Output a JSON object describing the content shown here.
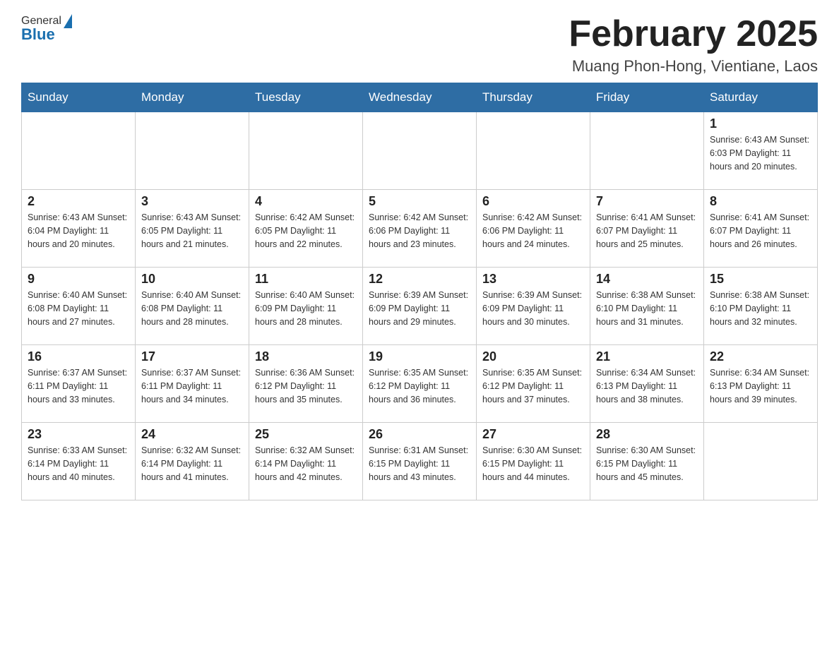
{
  "header": {
    "logo_general": "General",
    "logo_blue": "Blue",
    "month_title": "February 2025",
    "subtitle": "Muang Phon-Hong, Vientiane, Laos"
  },
  "weekdays": [
    "Sunday",
    "Monday",
    "Tuesday",
    "Wednesday",
    "Thursday",
    "Friday",
    "Saturday"
  ],
  "weeks": [
    [
      {
        "day": "",
        "info": ""
      },
      {
        "day": "",
        "info": ""
      },
      {
        "day": "",
        "info": ""
      },
      {
        "day": "",
        "info": ""
      },
      {
        "day": "",
        "info": ""
      },
      {
        "day": "",
        "info": ""
      },
      {
        "day": "1",
        "info": "Sunrise: 6:43 AM\nSunset: 6:03 PM\nDaylight: 11 hours and 20 minutes."
      }
    ],
    [
      {
        "day": "2",
        "info": "Sunrise: 6:43 AM\nSunset: 6:04 PM\nDaylight: 11 hours and 20 minutes."
      },
      {
        "day": "3",
        "info": "Sunrise: 6:43 AM\nSunset: 6:05 PM\nDaylight: 11 hours and 21 minutes."
      },
      {
        "day": "4",
        "info": "Sunrise: 6:42 AM\nSunset: 6:05 PM\nDaylight: 11 hours and 22 minutes."
      },
      {
        "day": "5",
        "info": "Sunrise: 6:42 AM\nSunset: 6:06 PM\nDaylight: 11 hours and 23 minutes."
      },
      {
        "day": "6",
        "info": "Sunrise: 6:42 AM\nSunset: 6:06 PM\nDaylight: 11 hours and 24 minutes."
      },
      {
        "day": "7",
        "info": "Sunrise: 6:41 AM\nSunset: 6:07 PM\nDaylight: 11 hours and 25 minutes."
      },
      {
        "day": "8",
        "info": "Sunrise: 6:41 AM\nSunset: 6:07 PM\nDaylight: 11 hours and 26 minutes."
      }
    ],
    [
      {
        "day": "9",
        "info": "Sunrise: 6:40 AM\nSunset: 6:08 PM\nDaylight: 11 hours and 27 minutes."
      },
      {
        "day": "10",
        "info": "Sunrise: 6:40 AM\nSunset: 6:08 PM\nDaylight: 11 hours and 28 minutes."
      },
      {
        "day": "11",
        "info": "Sunrise: 6:40 AM\nSunset: 6:09 PM\nDaylight: 11 hours and 28 minutes."
      },
      {
        "day": "12",
        "info": "Sunrise: 6:39 AM\nSunset: 6:09 PM\nDaylight: 11 hours and 29 minutes."
      },
      {
        "day": "13",
        "info": "Sunrise: 6:39 AM\nSunset: 6:09 PM\nDaylight: 11 hours and 30 minutes."
      },
      {
        "day": "14",
        "info": "Sunrise: 6:38 AM\nSunset: 6:10 PM\nDaylight: 11 hours and 31 minutes."
      },
      {
        "day": "15",
        "info": "Sunrise: 6:38 AM\nSunset: 6:10 PM\nDaylight: 11 hours and 32 minutes."
      }
    ],
    [
      {
        "day": "16",
        "info": "Sunrise: 6:37 AM\nSunset: 6:11 PM\nDaylight: 11 hours and 33 minutes."
      },
      {
        "day": "17",
        "info": "Sunrise: 6:37 AM\nSunset: 6:11 PM\nDaylight: 11 hours and 34 minutes."
      },
      {
        "day": "18",
        "info": "Sunrise: 6:36 AM\nSunset: 6:12 PM\nDaylight: 11 hours and 35 minutes."
      },
      {
        "day": "19",
        "info": "Sunrise: 6:35 AM\nSunset: 6:12 PM\nDaylight: 11 hours and 36 minutes."
      },
      {
        "day": "20",
        "info": "Sunrise: 6:35 AM\nSunset: 6:12 PM\nDaylight: 11 hours and 37 minutes."
      },
      {
        "day": "21",
        "info": "Sunrise: 6:34 AM\nSunset: 6:13 PM\nDaylight: 11 hours and 38 minutes."
      },
      {
        "day": "22",
        "info": "Sunrise: 6:34 AM\nSunset: 6:13 PM\nDaylight: 11 hours and 39 minutes."
      }
    ],
    [
      {
        "day": "23",
        "info": "Sunrise: 6:33 AM\nSunset: 6:14 PM\nDaylight: 11 hours and 40 minutes."
      },
      {
        "day": "24",
        "info": "Sunrise: 6:32 AM\nSunset: 6:14 PM\nDaylight: 11 hours and 41 minutes."
      },
      {
        "day": "25",
        "info": "Sunrise: 6:32 AM\nSunset: 6:14 PM\nDaylight: 11 hours and 42 minutes."
      },
      {
        "day": "26",
        "info": "Sunrise: 6:31 AM\nSunset: 6:15 PM\nDaylight: 11 hours and 43 minutes."
      },
      {
        "day": "27",
        "info": "Sunrise: 6:30 AM\nSunset: 6:15 PM\nDaylight: 11 hours and 44 minutes."
      },
      {
        "day": "28",
        "info": "Sunrise: 6:30 AM\nSunset: 6:15 PM\nDaylight: 11 hours and 45 minutes."
      },
      {
        "day": "",
        "info": ""
      }
    ]
  ]
}
